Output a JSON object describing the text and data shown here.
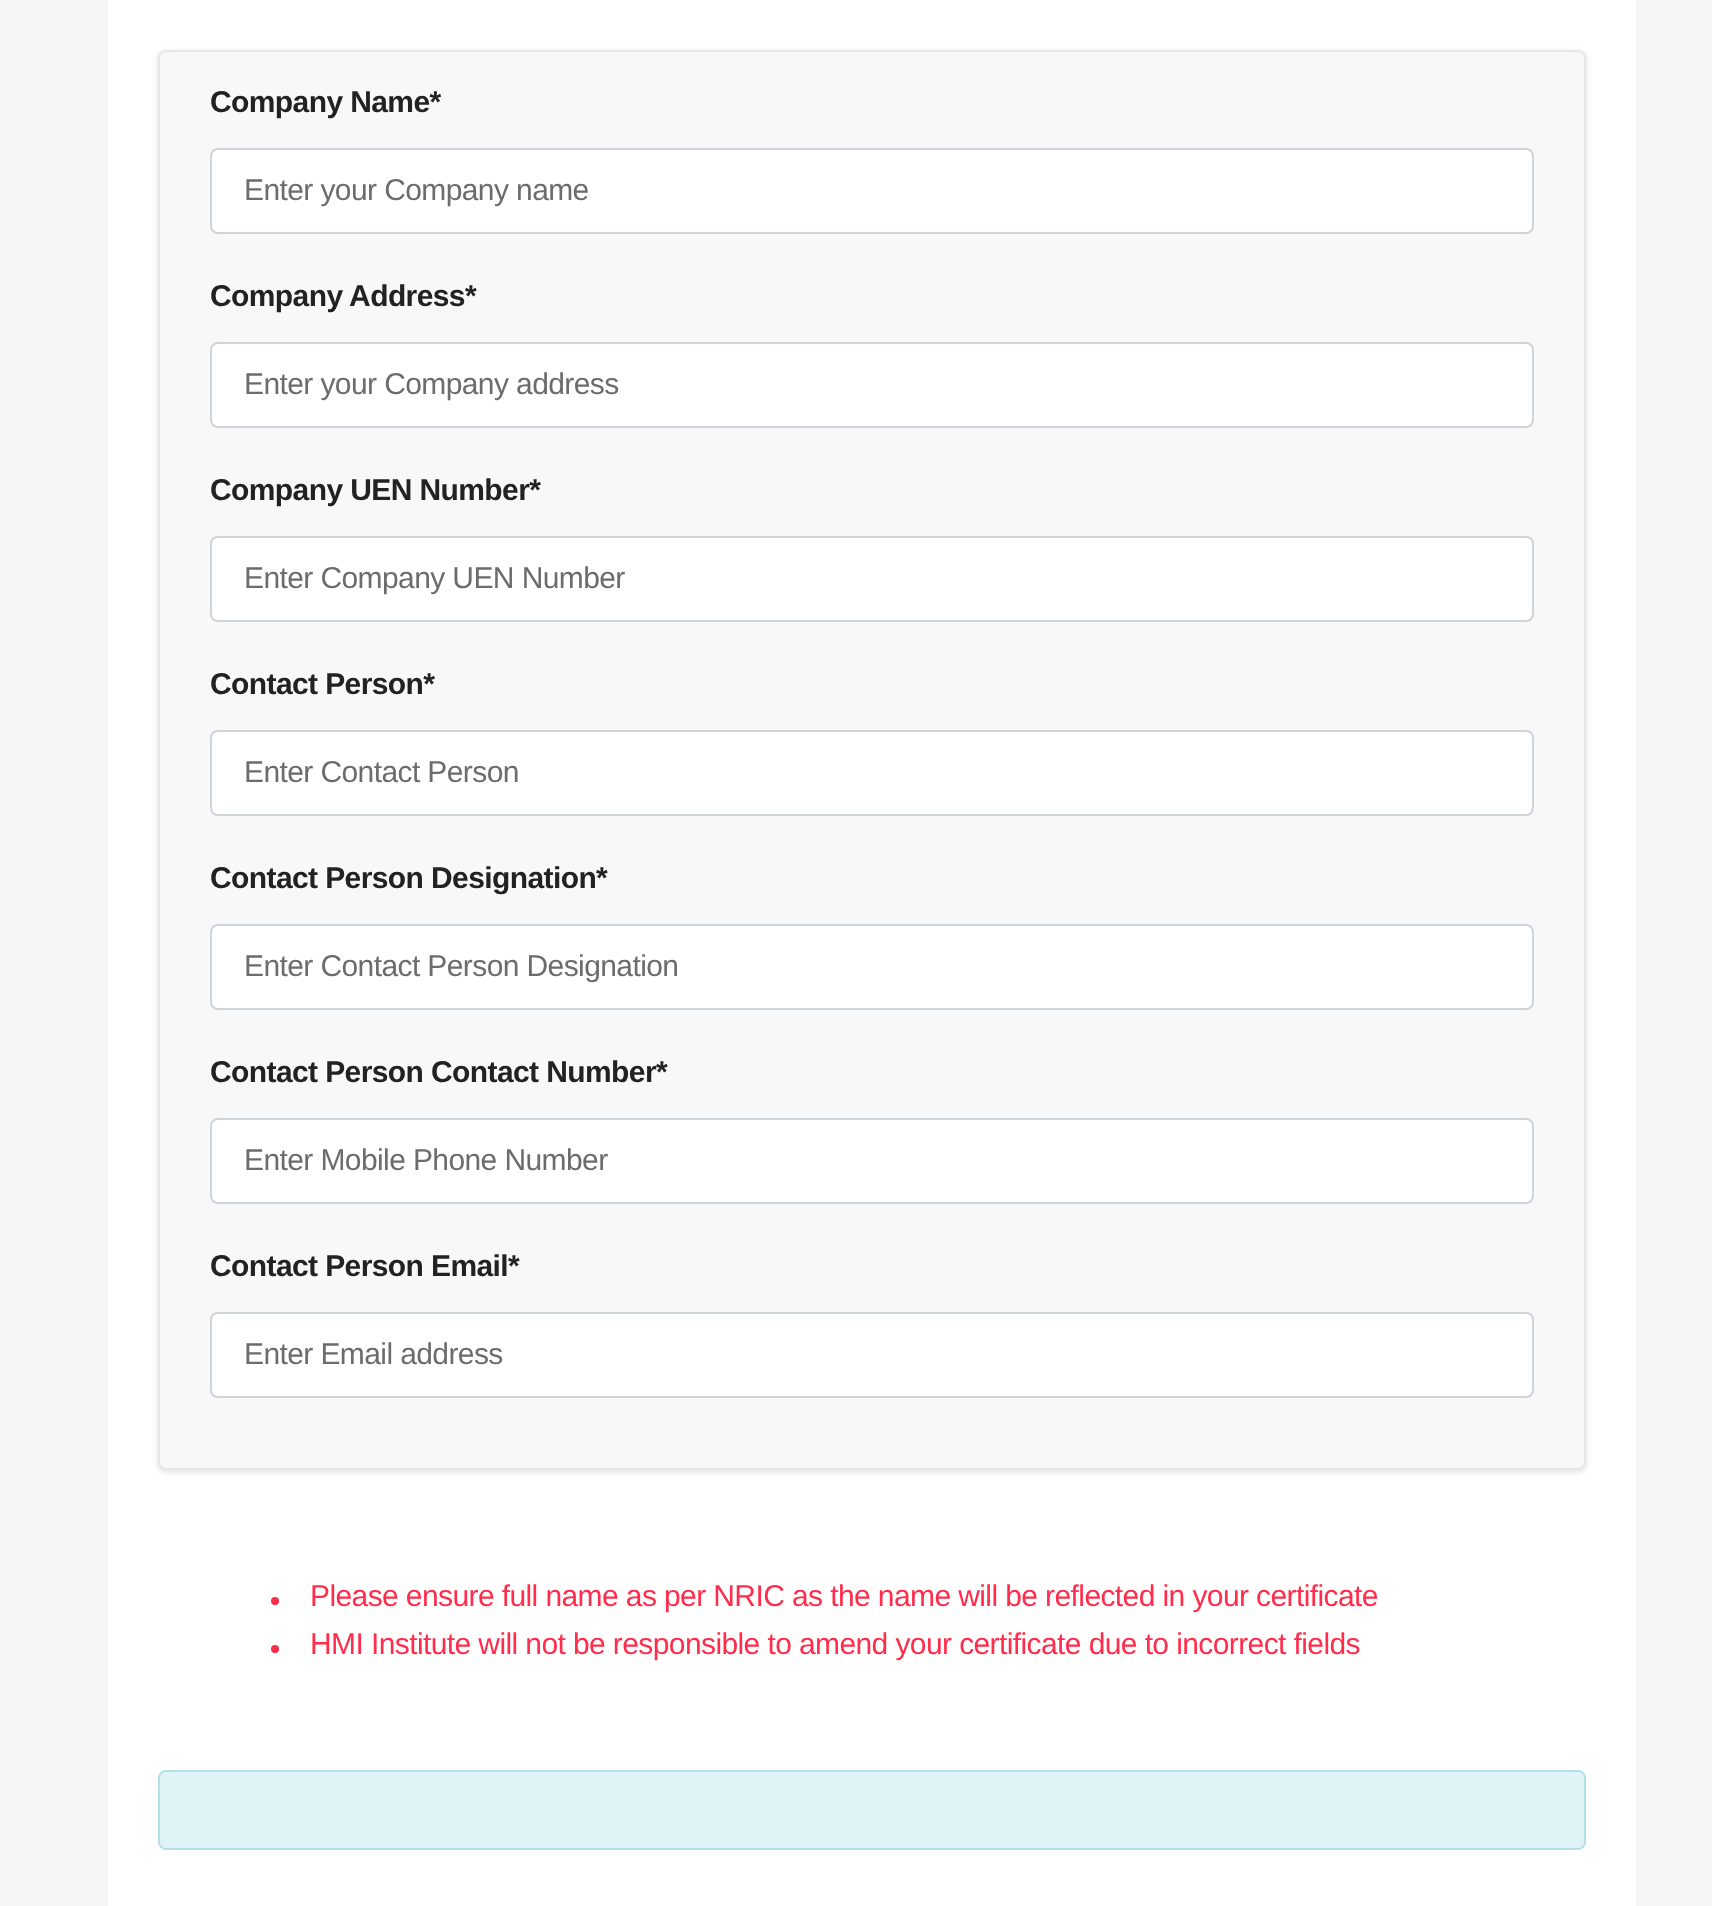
{
  "form_fields": [
    {
      "label": "Company Name*",
      "placeholder": "Enter your Company name"
    },
    {
      "label": "Company Address*",
      "placeholder": "Enter your Company address"
    },
    {
      "label": "Company UEN Number*",
      "placeholder": "Enter Company UEN Number"
    },
    {
      "label": "Contact Person*",
      "placeholder": "Enter Contact Person"
    },
    {
      "label": "Contact Person Designation*",
      "placeholder": "Enter Contact Person Designation"
    },
    {
      "label": "Contact Person Contact Number*",
      "placeholder": "Enter Mobile Phone Number"
    },
    {
      "label": "Contact Person Email*",
      "placeholder": "Enter Email address"
    }
  ],
  "notes": [
    "Please ensure full name as per NRIC as the name will be reflected in your certificate",
    "HMI Institute will not be responsible to amend your certificate due to incorrect fields"
  ]
}
